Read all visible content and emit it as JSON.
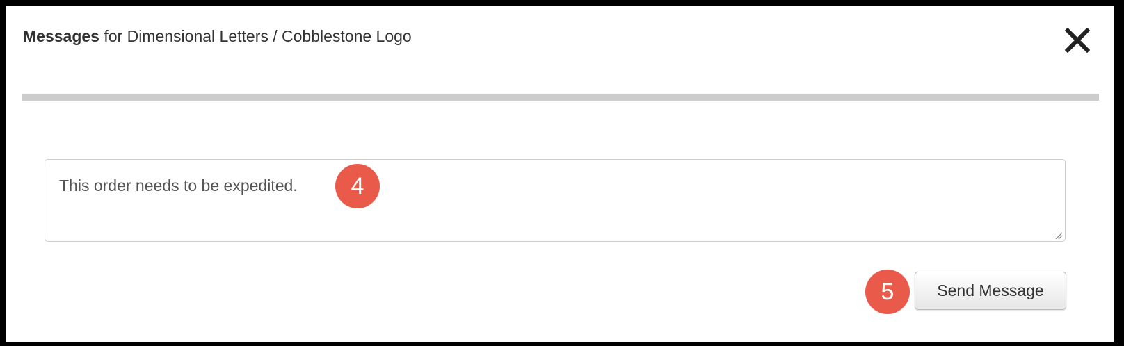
{
  "dialog": {
    "title_strong": "Messages",
    "title_rest": " for Dimensional Letters / Cobblestone Logo",
    "close_icon": "close-icon"
  },
  "message": {
    "value": "This order needs to be expedited."
  },
  "send_button": {
    "label": "Send Message"
  },
  "callouts": {
    "message_step": "4",
    "send_step": "5"
  },
  "colors": {
    "callout": "#ea5a4b",
    "divider": "#cccccc",
    "text": "#333333"
  }
}
